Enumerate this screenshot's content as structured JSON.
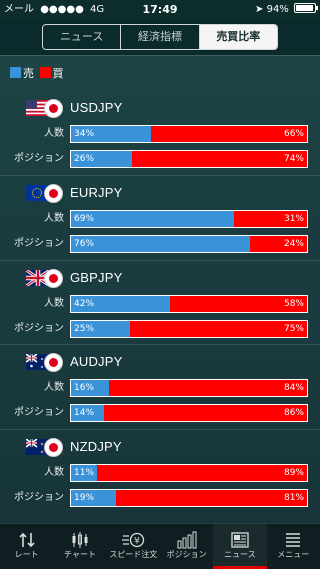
{
  "status_bar": {
    "carrier": "メール",
    "signal": "●●●●●",
    "network": "4G",
    "time": "17:49",
    "battery": "94%"
  },
  "top_tabs": [
    {
      "label": "ニュース",
      "active": false
    },
    {
      "label": "経済指標",
      "active": false
    },
    {
      "label": "売買比率",
      "active": true
    }
  ],
  "legend": {
    "sell_label": "売",
    "buy_label": "買",
    "sell_color": "#3a93d8",
    "buy_color": "#ff0000"
  },
  "row_labels": {
    "people": "人数",
    "position": "ポジション"
  },
  "pairs": [
    {
      "name": "USDJPY",
      "flag": "us-flag-icon",
      "people": {
        "sell": 34,
        "buy": 66,
        "sell_text": "34%",
        "buy_text": "66%"
      },
      "position": {
        "sell": 26,
        "buy": 74,
        "sell_text": "26%",
        "buy_text": "74%"
      }
    },
    {
      "name": "EURJPY",
      "flag": "eu-flag-icon",
      "people": {
        "sell": 69,
        "buy": 31,
        "sell_text": "69%",
        "buy_text": "31%"
      },
      "position": {
        "sell": 76,
        "buy": 24,
        "sell_text": "76%",
        "buy_text": "24%"
      }
    },
    {
      "name": "GBPJPY",
      "flag": "uk-flag-icon",
      "people": {
        "sell": 42,
        "buy": 58,
        "sell_text": "42%",
        "buy_text": "58%"
      },
      "position": {
        "sell": 25,
        "buy": 75,
        "sell_text": "25%",
        "buy_text": "75%"
      }
    },
    {
      "name": "AUDJPY",
      "flag": "au-flag-icon",
      "people": {
        "sell": 16,
        "buy": 84,
        "sell_text": "16%",
        "buy_text": "84%"
      },
      "position": {
        "sell": 14,
        "buy": 86,
        "sell_text": "14%",
        "buy_text": "86%"
      }
    },
    {
      "name": "NZDJPY",
      "flag": "nz-flag-icon",
      "people": {
        "sell": 11,
        "buy": 89,
        "sell_text": "11%",
        "buy_text": "89%"
      },
      "position": {
        "sell": 19,
        "buy": 81,
        "sell_text": "19%",
        "buy_text": "81%"
      }
    }
  ],
  "bottom_tabs": [
    {
      "label": "レート",
      "icon": "rate-arrows-icon",
      "active": false
    },
    {
      "label": "チャート",
      "icon": "candlestick-icon",
      "active": false
    },
    {
      "label": "スピード注文",
      "icon": "speed-order-icon",
      "active": false
    },
    {
      "label": "ポジション",
      "icon": "position-bars-icon",
      "active": false
    },
    {
      "label": "ニュース",
      "icon": "news-icon",
      "active": true
    },
    {
      "label": "メニュー",
      "icon": "menu-icon",
      "active": false
    }
  ]
}
